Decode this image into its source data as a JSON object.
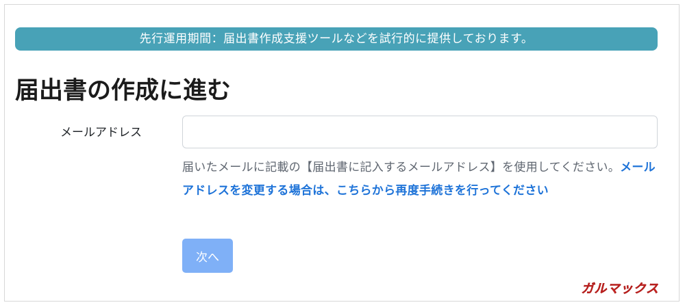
{
  "notice": {
    "text": "先行運用期間：届出書作成支援ツールなどを試行的に提供しております。"
  },
  "page": {
    "title": "届出書の作成に進む"
  },
  "form": {
    "email_label": "メールアドレス",
    "email_value": "",
    "help_text": "届いたメールに記載の【届出書に記入するメールアドレス】を使用してください。",
    "help_link": "メールアドレスを変更する場合は、こちらから再度手続きを行ってください",
    "next_label": "次へ"
  },
  "watermark": {
    "text": "ガルマックス"
  },
  "colors": {
    "notice_bg": "#48a2b7",
    "link": "#1e73d8",
    "button_bg": "#7fb0f7",
    "watermark": "#e1312f"
  }
}
